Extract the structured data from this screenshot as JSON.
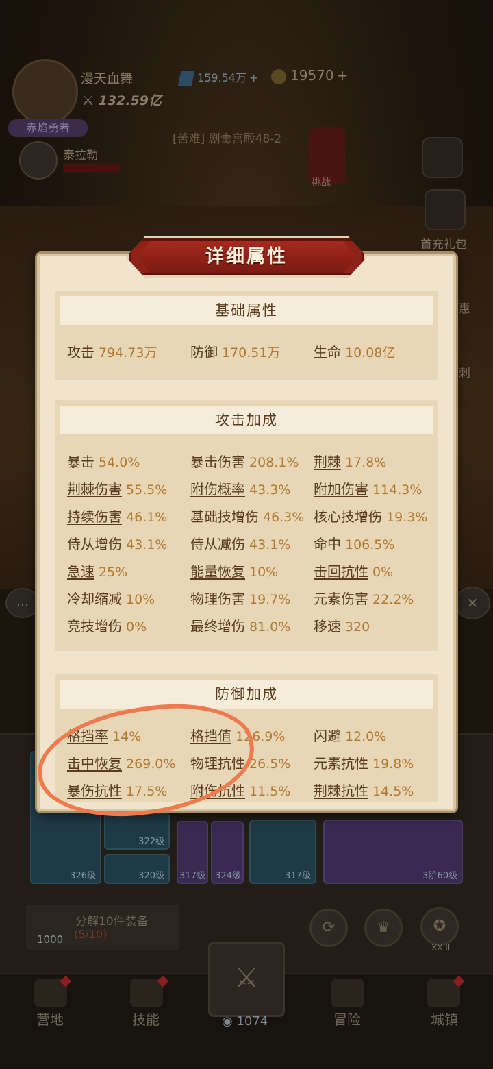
{
  "player": {
    "name": "漫天血舞",
    "power": "132.59亿",
    "title": "赤焰勇者",
    "ally_name": "泰拉勒"
  },
  "currency": {
    "gems": "159.54万",
    "coins": "19570",
    "plus": "+"
  },
  "stage": {
    "label": "[苦难] 剧毒宫殿48-2",
    "challenge": "挑战"
  },
  "side_menu": {
    "first_recharge": "首充礼包",
    "deal": "惠",
    "dash": "刺"
  },
  "dialog": {
    "title": "详细属性",
    "sections": {
      "basic": {
        "title": "基础属性",
        "stats": [
          {
            "name": "攻击",
            "value": "794.73万"
          },
          {
            "name": "防御",
            "value": "170.51万"
          },
          {
            "name": "生命",
            "value": "10.08亿"
          }
        ]
      },
      "attack": {
        "title": "攻击加成",
        "stats": [
          {
            "name": "暴击",
            "value": "54.0%"
          },
          {
            "name": "暴击伤害",
            "value": "208.1%"
          },
          {
            "name": "荆棘",
            "value": "17.8%"
          },
          {
            "name": "荆棘伤害",
            "value": "55.5%"
          },
          {
            "name": "附伤概率",
            "value": "43.3%"
          },
          {
            "name": "附加伤害",
            "value": "114.3%"
          },
          {
            "name": "持续伤害",
            "value": "46.1%"
          },
          {
            "name": "基础技增伤",
            "value": "46.3%"
          },
          {
            "name": "核心技增伤",
            "value": "19.3%"
          },
          {
            "name": "侍从增伤",
            "value": "43.1%"
          },
          {
            "name": "侍从减伤",
            "value": "43.1%"
          },
          {
            "name": "命中",
            "value": "106.5%"
          },
          {
            "name": "急速",
            "value": "25%"
          },
          {
            "name": "能量恢复",
            "value": "10%"
          },
          {
            "name": "击回抗性",
            "value": "0%"
          },
          {
            "name": "冷却缩减",
            "value": "10%"
          },
          {
            "name": "物理伤害",
            "value": "19.7%"
          },
          {
            "name": "元素伤害",
            "value": "22.2%"
          },
          {
            "name": "竞技增伤",
            "value": "0%"
          },
          {
            "name": "最终增伤",
            "value": "81.0%"
          },
          {
            "name": "移速",
            "value": "320"
          }
        ]
      },
      "defense": {
        "title": "防御加成",
        "stats": [
          {
            "name": "格挡率",
            "value": "14%"
          },
          {
            "name": "格挡值",
            "value": "126.9%"
          },
          {
            "name": "闪避",
            "value": "12.0%"
          },
          {
            "name": "击中恢复",
            "value": "269.0%"
          },
          {
            "name": "物理抗性",
            "value": "26.5%"
          },
          {
            "name": "元素抗性",
            "value": "19.8%"
          },
          {
            "name": "暴伤抗性",
            "value": "17.5%"
          },
          {
            "name": "附伤抗性",
            "value": "11.5%"
          },
          {
            "name": "荆棘抗性",
            "value": "14.5%"
          }
        ]
      }
    }
  },
  "equipment": {
    "levels": [
      "326级",
      "322级",
      "320级",
      "317级",
      "324级",
      "317级",
      "3阶60级"
    ],
    "decompose_text": "分解10件装备",
    "decompose_progress": "(5/10)",
    "decompose_cost": "1000",
    "rank": "XX II"
  },
  "nav": {
    "camp": "营地",
    "skills": "技能",
    "battle_count": "1074",
    "adventure": "冒险",
    "town": "城镇"
  }
}
